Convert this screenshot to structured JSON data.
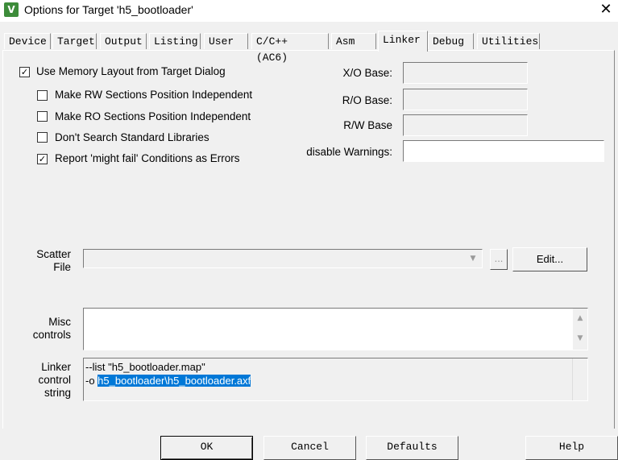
{
  "window": {
    "title": "Options for Target 'h5_bootloader'",
    "icon": "keil-uv-icon",
    "close_glyph": "✕"
  },
  "tabs": [
    {
      "label": "Device"
    },
    {
      "label": "Target"
    },
    {
      "label": "Output"
    },
    {
      "label": "Listing"
    },
    {
      "label": "User"
    },
    {
      "label": "C/C++ (AC6)"
    },
    {
      "label": "Asm"
    },
    {
      "label": "Linker",
      "active": true
    },
    {
      "label": "Debug"
    },
    {
      "label": "Utilities"
    }
  ],
  "options": {
    "use_memory_layout": {
      "label": "Use Memory Layout from Target Dialog",
      "checked": true
    },
    "rw_independent": {
      "label": "Make RW Sections Position Independent",
      "checked": false
    },
    "ro_independent": {
      "label": "Make RO Sections Position Independent",
      "checked": false
    },
    "no_std_libs": {
      "label": "Don't Search Standard Libraries",
      "checked": false
    },
    "might_fail_errors": {
      "label": "Report 'might fail' Conditions as Errors",
      "checked": true
    }
  },
  "check_glyph": "✓",
  "fields": {
    "xo_base": {
      "label": "X/O Base:",
      "value": ""
    },
    "ro_base": {
      "label": "R/O Base:",
      "value": ""
    },
    "rw_base": {
      "label": "R/W Base",
      "value": ""
    },
    "disable_warnings": {
      "label": "disable Warnings:",
      "value": ""
    }
  },
  "scatter": {
    "label_line1": "Scatter",
    "label_line2": "File",
    "value": "",
    "browse_label": "...",
    "edit_label": "Edit..."
  },
  "misc": {
    "label_line1": "Misc",
    "label_line2": "controls",
    "value": "",
    "scroll_up": "▲",
    "scroll_down": "▼"
  },
  "linker_control": {
    "label_line1": "Linker",
    "label_line2": "control",
    "label_line3": "string",
    "line1": "--list \"h5_bootloader.map\"",
    "line2_prefix": "-o ",
    "line2_selected": "h5_bootloader\\h5_bootloader.axf"
  },
  "buttons": {
    "ok": "OK",
    "cancel": "Cancel",
    "defaults": "Defaults",
    "help": "Help"
  }
}
